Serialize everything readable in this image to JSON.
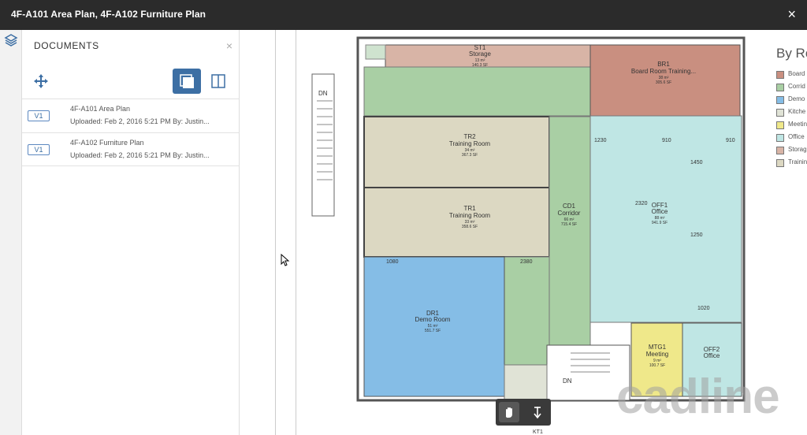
{
  "window": {
    "title": "4F-A101 Area Plan, 4F-A102 Furniture Plan",
    "close_glyph": "×"
  },
  "panel": {
    "header": "DOCUMENTS",
    "close_glyph": "×",
    "documents": [
      {
        "version": "V1",
        "name": "4F-A101 Area Plan",
        "meta": "Uploaded: Feb 2, 2016 5:21 PM By: Justin..."
      },
      {
        "version": "V1",
        "name": "4F-A102 Furniture Plan",
        "meta": "Uploaded: Feb 2, 2016 5:21 PM By: Justin..."
      }
    ]
  },
  "legend": {
    "title": "By Ro",
    "items": [
      {
        "label": "Board",
        "color": "#c98f80"
      },
      {
        "label": "Corrid",
        "color": "#a9cfa4"
      },
      {
        "label": "Demo",
        "color": "#85bde6"
      },
      {
        "label": "Kitche",
        "color": "#e0e3d6"
      },
      {
        "label": "Meetin",
        "color": "#efe88a"
      },
      {
        "label": "Office",
        "color": "#bfe6e4"
      },
      {
        "label": "Storag",
        "color": "#d8b4a6"
      },
      {
        "label": "Trainin",
        "color": "#dcd8c2"
      }
    ]
  },
  "rooms": {
    "st1": {
      "code": "ST1",
      "name": "Storage",
      "area_m": "13 m²",
      "area_sf": "140.3 SF"
    },
    "br1": {
      "code": "BR1",
      "name": "Board Room Training...",
      "area_m": "38 m²",
      "area_sf": "305.6 SF"
    },
    "tr2": {
      "code": "TR2",
      "name": "Training Room",
      "area_m": "34 m²",
      "area_sf": "367.3 SF"
    },
    "tr1": {
      "code": "TR1",
      "name": "Training Room",
      "area_m": "33 m²",
      "area_sf": "358.6 SF"
    },
    "cd1": {
      "code": "CD1",
      "name": "Corridor",
      "area_m": "66 m²",
      "area_sf": "715.4 SF"
    },
    "off1": {
      "code": "OFF1",
      "name": "Office",
      "area_m": "88 m²",
      "area_sf": "941.9 SF"
    },
    "dr1": {
      "code": "DR1",
      "name": "Demo Room",
      "area_m": "51 m²",
      "area_sf": "551.7 SF"
    },
    "mtg1": {
      "code": "MTG1",
      "name": "Meeting",
      "area_m": "9 m²",
      "area_sf": "100.7 SF"
    },
    "off2": {
      "code": "OFF2",
      "name": "Office"
    },
    "kt1": {
      "code": "KT1"
    }
  },
  "dimensions": [
    "1230",
    "910",
    "910",
    "1450",
    "2320",
    "1250",
    "1020",
    "1080",
    "2380"
  ],
  "stairs": [
    "DN",
    "DN"
  ],
  "watermark": "cadline"
}
